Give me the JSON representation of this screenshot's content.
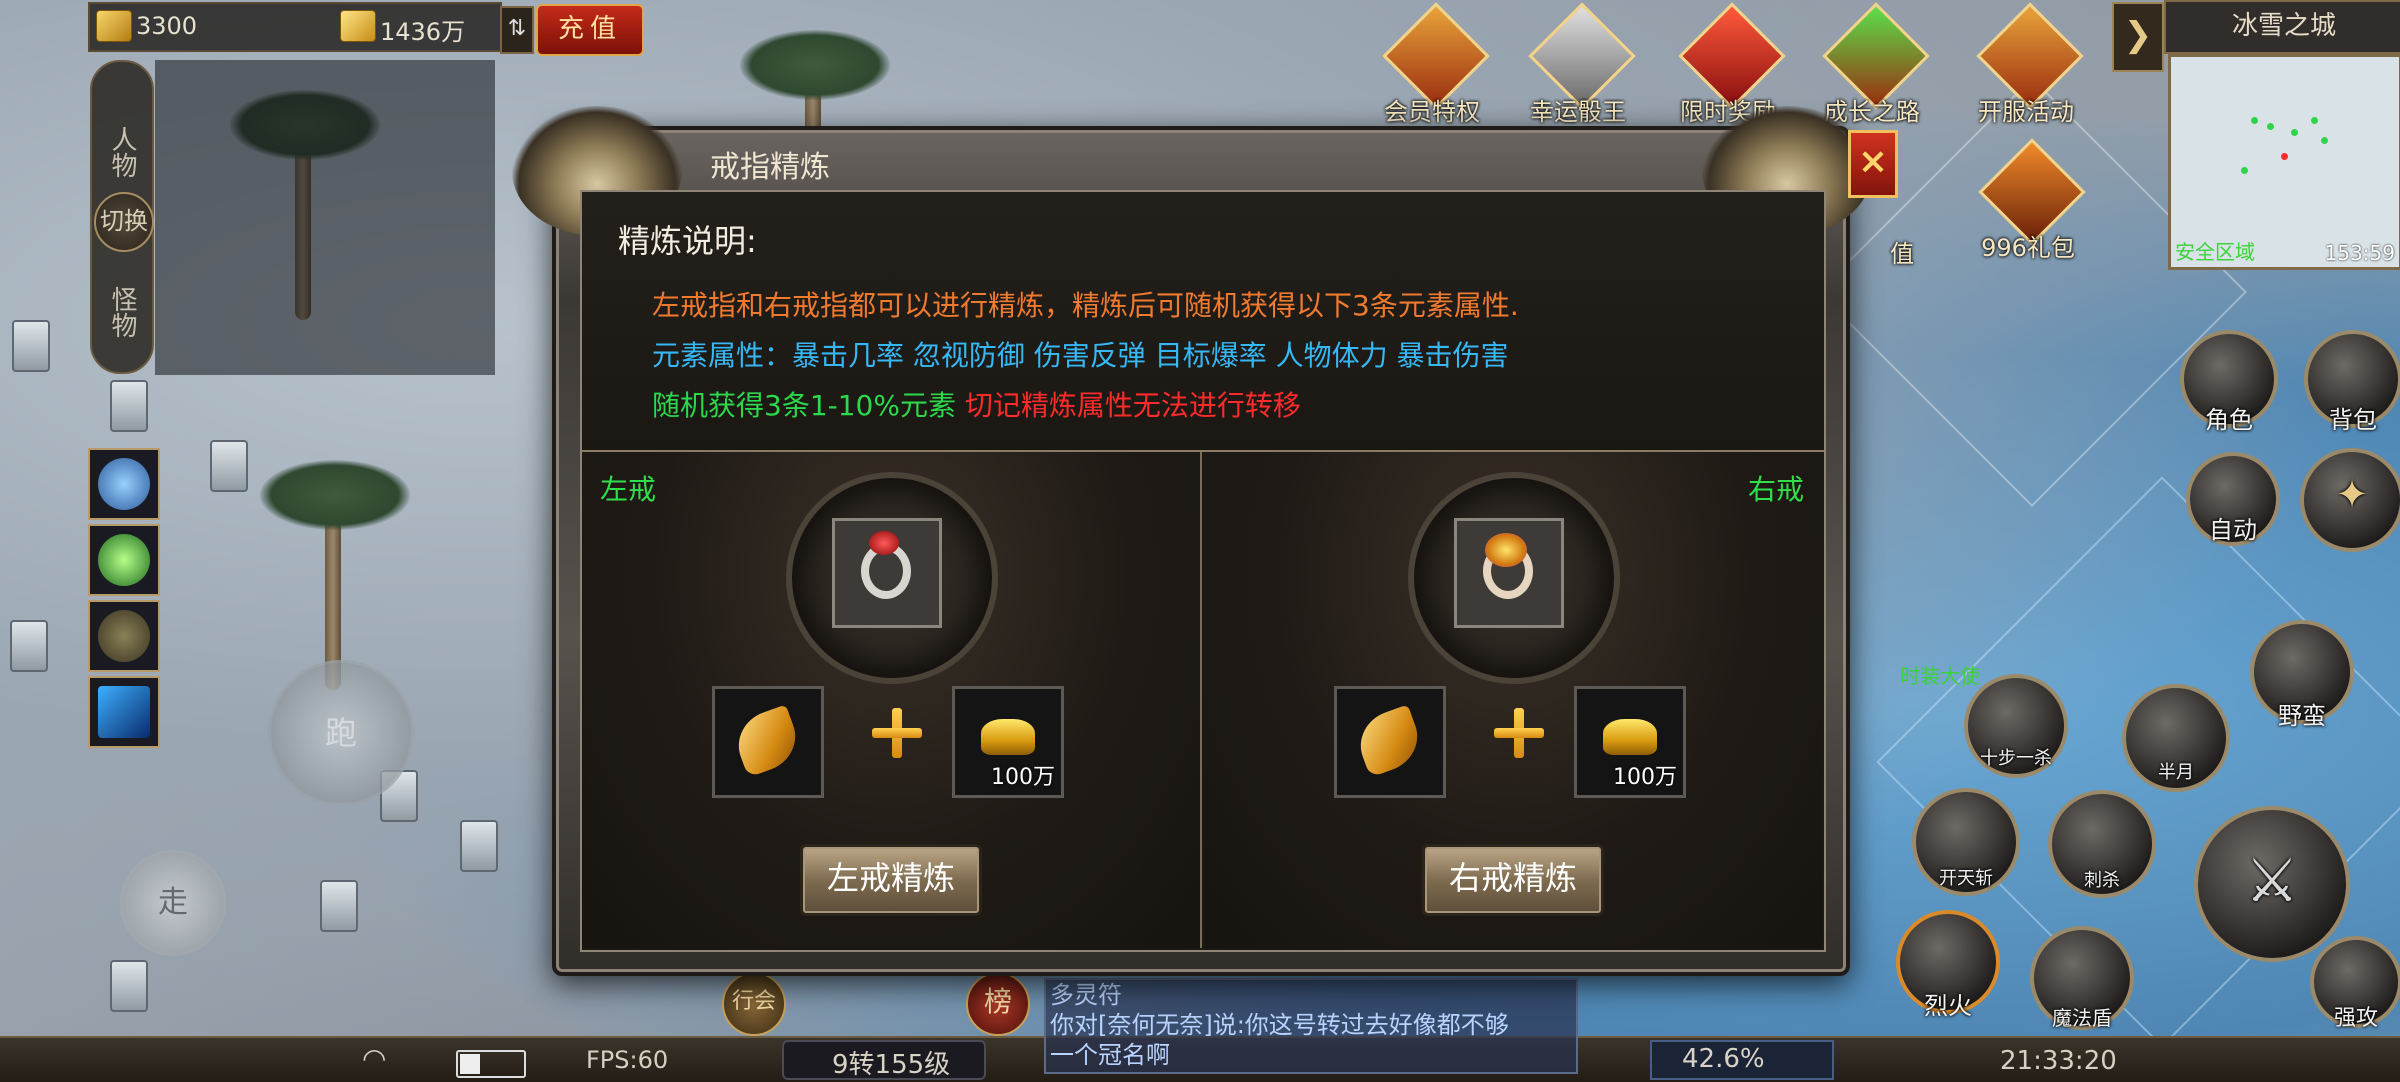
{
  "resources": {
    "ingot_amount": "3300",
    "gold_amount": "1436万",
    "swap_label": "⇅",
    "recharge_label": "充值"
  },
  "left_tabs": {
    "person": "人物",
    "switch": "切换",
    "monster": "怪物"
  },
  "controls": {
    "run": "跑",
    "walk": "走"
  },
  "activities": [
    {
      "label": "会员特权"
    },
    {
      "label": "幸运骰王"
    },
    {
      "label": "限时奖励"
    },
    {
      "label": "成长之路"
    },
    {
      "label": "开服活动"
    }
  ],
  "activities_row2": [
    {
      "label": "值"
    },
    {
      "label": "996礼包"
    }
  ],
  "minimap": {
    "title": "冰雪之城",
    "safe_zone": "安全区域",
    "coord": "153:59"
  },
  "right_buttons": {
    "role": "角色",
    "bag": "背包",
    "auto": "自动"
  },
  "skills": {
    "skill1": "十步一杀",
    "skill2": "半月",
    "skill3": "野蛮",
    "skill4": "开天斩",
    "skill5": "刺杀",
    "skill6": "烈火",
    "skill7": "魔法盾",
    "skill8": "强攻"
  },
  "npc_label": "时装大使",
  "dialog": {
    "title": "戒指精炼",
    "close": "×",
    "desc_title": "精炼说明:",
    "line1": "左戒指和右戒指都可以进行精炼，精炼后可随机获得以下3条元素属性.",
    "line2": "元素属性：暴击几率 忽视防御 伤害反弹 目标爆率 人物体力 暴击伤害",
    "line3_green": "随机获得3条1-10%元素",
    "line3_red": "切记精炼属性无法进行转移",
    "left": {
      "label": "左戒",
      "gold_qty": "100万",
      "button": "左戒精炼"
    },
    "right": {
      "label": "右戒",
      "gold_qty": "100万",
      "button": "右戒精炼"
    }
  },
  "chat": {
    "line1": "多灵符",
    "line2": "你对[奈何无奈]说:你这号转过去好像都不够",
    "line3": "一个冠名啊"
  },
  "status": {
    "fps": "FPS:60",
    "level": "9转155级",
    "exp": "42.6%",
    "time": "21:33:20",
    "rank": "榜",
    "guild": "行会"
  },
  "colors": {
    "accent_gold": "#f0c15c",
    "green_label": "#2fe04a",
    "red_warning": "#ff2a2a",
    "blue_attr": "#35b8f5",
    "orange_desc": "#f07a2e"
  }
}
